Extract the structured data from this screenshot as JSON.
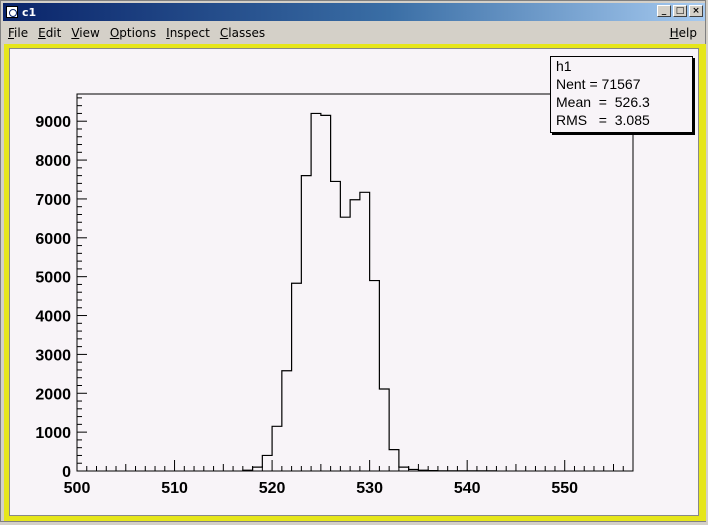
{
  "window": {
    "title": "c1",
    "buttons": [
      "_",
      "□",
      "×"
    ]
  },
  "menubar": {
    "items": [
      {
        "label": "File",
        "underline": "F",
        "rest": "ile"
      },
      {
        "label": "Edit",
        "underline": "E",
        "rest": "dit"
      },
      {
        "label": "View",
        "underline": "V",
        "rest": "iew"
      },
      {
        "label": "Options",
        "underline": "O",
        "rest": "ptions"
      },
      {
        "label": "Inspect",
        "underline": "I",
        "rest": "nspect"
      },
      {
        "label": "Classes",
        "underline": "C",
        "rest": "lasses"
      }
    ],
    "help": {
      "underline": "H",
      "rest": "elp"
    }
  },
  "stats": {
    "name": "h1",
    "nent_label": "Nent",
    "nent_value": "71567",
    "mean_label": "Mean",
    "mean_value": "526.3",
    "rms_label": "RMS",
    "rms_value": "3.085"
  },
  "chart_data": {
    "type": "bar",
    "title": "",
    "xlabel": "",
    "ylabel": "",
    "xlim": [
      500,
      557
    ],
    "ylim": [
      0,
      9700
    ],
    "x_ticks": [
      500,
      510,
      520,
      530,
      540,
      550
    ],
    "y_ticks": [
      0,
      1000,
      2000,
      3000,
      4000,
      5000,
      6000,
      7000,
      8000,
      9000
    ],
    "bin_edges_start": 517,
    "bin_width": 1,
    "values": [
      20,
      100,
      400,
      1150,
      2580,
      4830,
      7600,
      9200,
      9150,
      7450,
      6530,
      6980,
      7170,
      4900,
      2110,
      550,
      100,
      40,
      20,
      10,
      5,
      5,
      5,
      5,
      5,
      5
    ],
    "colors": {
      "line": "#000000",
      "background": "#f8f4f8",
      "frame": "#e6e61a"
    }
  }
}
